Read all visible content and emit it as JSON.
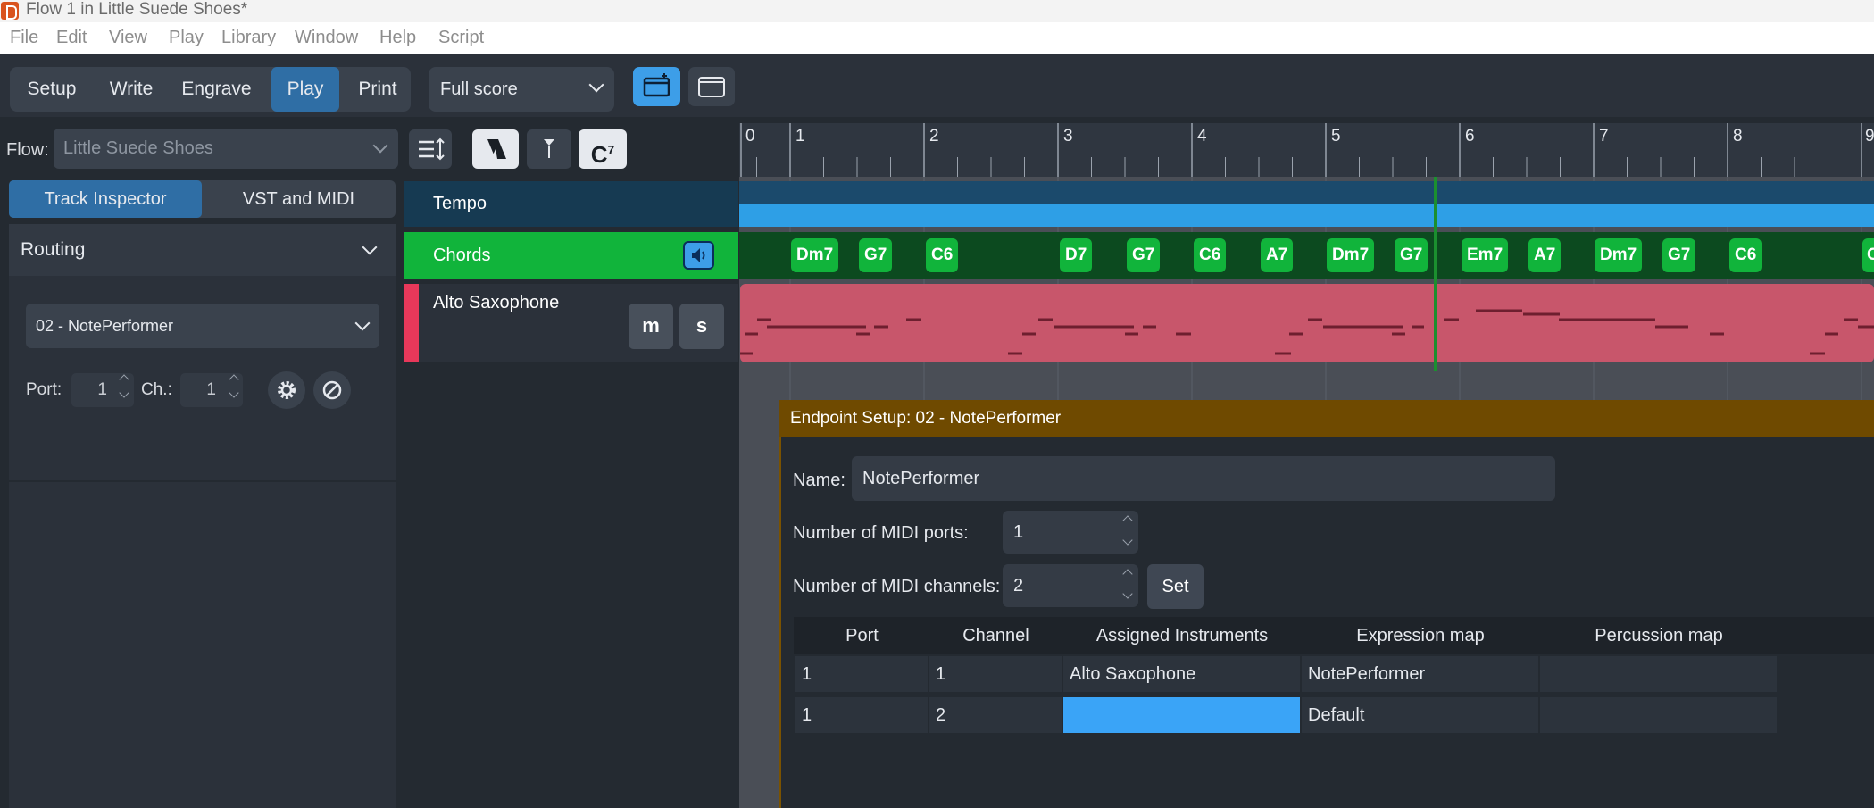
{
  "window": {
    "title": "Flow 1 in Little Suede Shoes*"
  },
  "menu": [
    "File",
    "Edit",
    "View",
    "Play",
    "Library",
    "Window",
    "Help",
    "Script"
  ],
  "modes": {
    "items": [
      "Setup",
      "Write",
      "Engrave",
      "Play",
      "Print"
    ],
    "active": "Play"
  },
  "layout_select": {
    "value": "Full score"
  },
  "flow": {
    "label": "Flow:",
    "value": "Little Suede Shoes"
  },
  "chord_tool_label": "C",
  "chord_tool_sup": "7",
  "left_tabs": {
    "items": [
      "Track Inspector",
      "VST and MIDI"
    ],
    "active": "Track Inspector"
  },
  "routing": {
    "title": "Routing",
    "device": "02 - NotePerformer",
    "port_label": "Port:",
    "port_value": "1",
    "channel_label": "Ch.:",
    "channel_value": "1"
  },
  "tracks": {
    "tempo": "Tempo",
    "chords": "Chords",
    "sax": "Alto Saxophone",
    "mute_label": "m",
    "solo_label": "s"
  },
  "ruler": {
    "bars": [
      "0",
      "1",
      "2",
      "3",
      "4",
      "5",
      "6",
      "7",
      "8",
      "9"
    ]
  },
  "chords": [
    "Dm7",
    "G7",
    "C6",
    "D7",
    "G7",
    "C6",
    "A7",
    "Dm7",
    "G7",
    "Em7",
    "A7",
    "Dm7",
    "G7",
    "C6",
    "C"
  ],
  "dialog": {
    "title": "Endpoint Setup: 02 - NotePerformer",
    "name_label": "Name:",
    "name_value": "NotePerformer",
    "ports_label": "Number of MIDI ports:",
    "ports_value": "1",
    "channels_label": "Number of MIDI channels:",
    "channels_value": "2",
    "set_label": "Set",
    "table": {
      "headers": [
        "Port",
        "Channel",
        "Assigned Instruments",
        "Expression map",
        "Percussion map"
      ],
      "rows": [
        [
          "1",
          "1",
          "Alto Saxophone",
          "NotePerformer",
          ""
        ],
        [
          "1",
          "2",
          "",
          "Default",
          ""
        ]
      ]
    }
  },
  "colors": {
    "accent": "#2f6ea5",
    "chord_green": "#11b43b",
    "tempo_blue": "#2e9fe6",
    "sax_region": "#c8566b",
    "dialog_title_bg": "#6f4a00",
    "selected_cell": "#3aa4f7"
  },
  "icons": [
    "app-icon",
    "chevron-down-icon",
    "galley-view-icon",
    "page-view-icon",
    "track-height-icon",
    "select-tool-icon",
    "marker-tool-icon",
    "chord-tool-icon",
    "speaker-icon",
    "gear-icon",
    "disable-icon"
  ]
}
